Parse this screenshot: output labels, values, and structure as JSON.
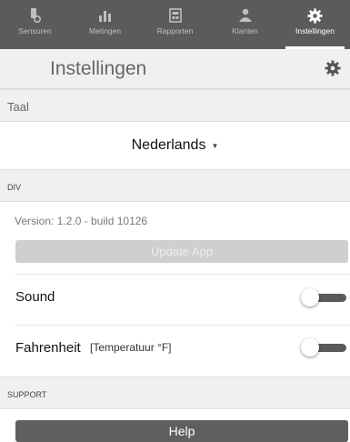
{
  "tabs": [
    {
      "label": "Sensoren",
      "icon": "sensor-icon"
    },
    {
      "label": "Metingen",
      "icon": "bar-chart-icon"
    },
    {
      "label": "Rapporten",
      "icon": "report-icon"
    },
    {
      "label": "Klanten",
      "icon": "customers-icon"
    },
    {
      "label": "Instellingen",
      "icon": "gear-icon",
      "active": true
    }
  ],
  "header": {
    "title": "Instellingen",
    "icon": "gear-icon"
  },
  "language": {
    "section_label": "Taal",
    "selected": "Nederlands"
  },
  "div": {
    "section_label": "DIV",
    "version": "Version: 1.2.0 - build 10126",
    "update_label": "Update App"
  },
  "settings": {
    "sound": {
      "label": "Sound",
      "enabled": false
    },
    "fahrenheit": {
      "label": "Fahrenheit",
      "hint": "[Temperatuur °F]",
      "enabled": false
    }
  },
  "support": {
    "section_label": "SUPPORT",
    "help_label": "Help"
  },
  "colors": {
    "tabbar": "#5b5b5b",
    "section_bg": "#f0f0f0",
    "button_dark": "#5f5f5f",
    "button_disabled": "#cfcfcf"
  }
}
